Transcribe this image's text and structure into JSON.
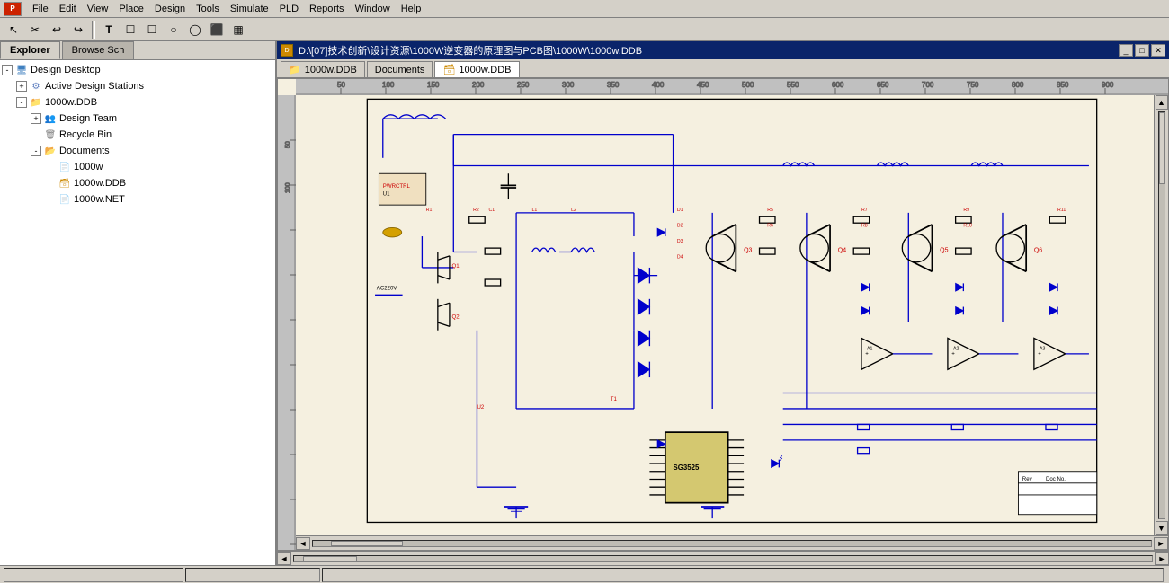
{
  "menubar": {
    "logo": "P",
    "items": [
      "File",
      "Edit",
      "View",
      "Place",
      "Design",
      "Tools",
      "Simulate",
      "PLD",
      "Reports",
      "Window",
      "Help"
    ]
  },
  "toolbar": {
    "tools": [
      "↖",
      "✂",
      "↩",
      "↪",
      "T",
      "☐",
      "☐",
      "○",
      "◯",
      "⬛",
      "▦"
    ]
  },
  "leftpanel": {
    "tabs": [
      "Explorer",
      "Browse Sch"
    ],
    "active_tab": "Explorer",
    "tree": {
      "items": [
        {
          "id": "design-desktop",
          "label": "Design Desktop",
          "level": 0,
          "icon": "desktop",
          "expanded": true
        },
        {
          "id": "active-stations",
          "label": "Active Design Stations",
          "level": 1,
          "icon": "stations",
          "expanded": false
        },
        {
          "id": "1000w-ddb",
          "label": "1000w.DDB",
          "level": 1,
          "icon": "folder-yellow",
          "expanded": true
        },
        {
          "id": "design-team",
          "label": "Design Team",
          "level": 2,
          "icon": "team",
          "expanded": false
        },
        {
          "id": "recycle-bin",
          "label": "Recycle Bin",
          "level": 2,
          "icon": "recycle",
          "expanded": false
        },
        {
          "id": "documents",
          "label": "Documents",
          "level": 2,
          "icon": "folder-yellow",
          "expanded": true
        },
        {
          "id": "1000w-sch",
          "label": "1000w",
          "level": 3,
          "icon": "sch",
          "expanded": false
        },
        {
          "id": "1000w-ddb-file",
          "label": "1000w.DDB",
          "level": 3,
          "icon": "ddb",
          "expanded": false
        },
        {
          "id": "1000w-net",
          "label": "1000w.NET",
          "level": 3,
          "icon": "net",
          "expanded": false
        }
      ]
    }
  },
  "rightpanel": {
    "titlebar": {
      "icon": "ddb-icon",
      "path": "D:\\[07]技术创新\\设计资源\\1000W逆变器的原理图与PCB图\\1000W\\1000w.DDB"
    },
    "tabs": [
      {
        "label": "1000w.DDB",
        "icon": "folder"
      },
      {
        "label": "Documents",
        "icon": "none"
      },
      {
        "label": "1000w.DDB",
        "icon": "ddb",
        "active": true
      }
    ]
  },
  "statusbar": {
    "sections": [
      "",
      "",
      ""
    ]
  }
}
